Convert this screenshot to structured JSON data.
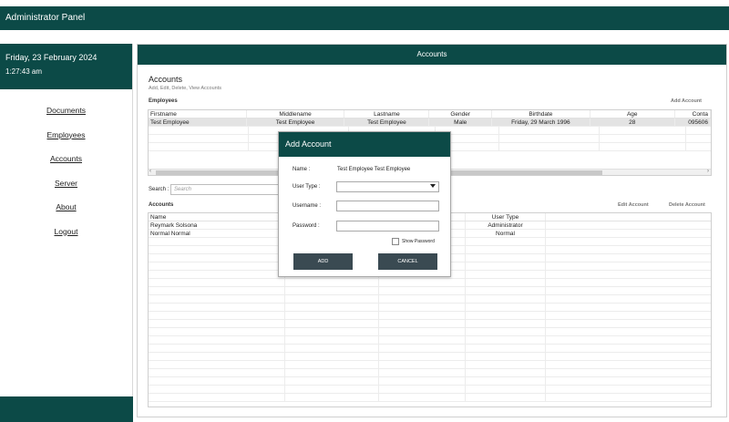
{
  "app": {
    "title": "Administrator Panel"
  },
  "sidebar": {
    "date": "Friday, 23 February 2024",
    "time": "1:27:43 am",
    "items": [
      {
        "label": "Documents"
      },
      {
        "label": "Employees"
      },
      {
        "label": "Accounts"
      },
      {
        "label": "Server"
      },
      {
        "label": "About"
      },
      {
        "label": "Logout"
      }
    ]
  },
  "main": {
    "header": "Accounts",
    "title": "Accounts",
    "subtitle": "Add, Edit, Delete, View Accounts",
    "employees": {
      "label": "Employees",
      "add_label": "Add Account",
      "columns": [
        "Firstname",
        "Middlename",
        "Lastname",
        "Gender",
        "Birthdate",
        "Age",
        "Conta"
      ],
      "rows": [
        [
          "Test Employee",
          "Test Employee",
          "Test Employee",
          "Male",
          "Friday, 29 March 1996",
          "28",
          "095606"
        ]
      ]
    },
    "search": {
      "label": "Search :",
      "placeholder": "Search"
    },
    "accounts": {
      "label": "Accounts",
      "edit_label": "Edit Account",
      "delete_label": "Delete Account",
      "columns": [
        "Name",
        "",
        "",
        "User Type"
      ],
      "rows": [
        [
          "Reymark Solsona",
          "",
          "",
          "Administrator"
        ],
        [
          "Normal Normal",
          "",
          "",
          "Normal"
        ]
      ]
    }
  },
  "dialog": {
    "title": "Add Account",
    "name_label": "Name :",
    "name_value": "Test Employee Test Employee",
    "user_type_label": "User Type :",
    "username_label": "Username :",
    "password_label": "Password :",
    "show_password_label": "Show Password",
    "add_label": "ADD",
    "cancel_label": "CANCEL"
  }
}
